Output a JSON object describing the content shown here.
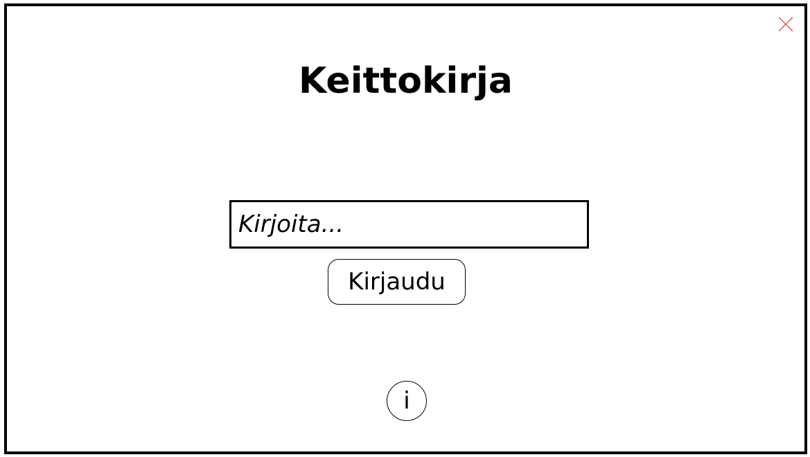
{
  "window": {
    "close_icon": "close-icon",
    "close_color": "#e03030"
  },
  "header": {
    "title": "Keittokirja"
  },
  "login": {
    "input_placeholder": "Kirjoita...",
    "input_value": "",
    "button_label": "Kirjaudu"
  },
  "footer": {
    "info_label": "i",
    "info_icon": "info-icon"
  }
}
